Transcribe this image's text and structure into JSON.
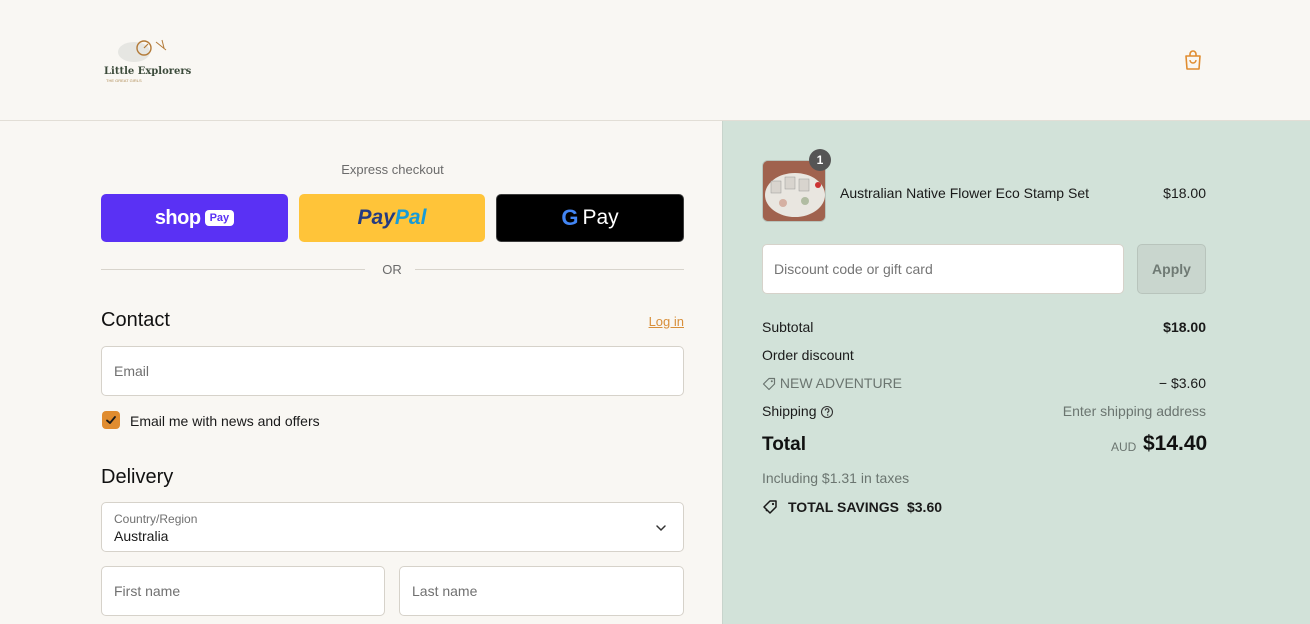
{
  "header": {
    "logo_text": "Little Explorers",
    "logo_sub": "THE GREAT             GIRLS",
    "bag_icon": "shopping-bag-icon"
  },
  "express": {
    "title": "Express checkout",
    "shop_pay": {
      "word": "shop",
      "pay": "Pay"
    },
    "paypal": {
      "part1": "Pay",
      "part2": "Pal"
    },
    "gpay": {
      "g": "G",
      "word": "Pay"
    },
    "or_text": "OR"
  },
  "contact": {
    "title": "Contact",
    "login_link": "Log in",
    "email_placeholder": "Email",
    "newsletter_label": "Email me with news and offers",
    "newsletter_checked": true
  },
  "delivery": {
    "title": "Delivery",
    "country_label": "Country/Region",
    "country_value": "Australia",
    "first_name_placeholder": "First name",
    "last_name_placeholder": "Last name"
  },
  "summary": {
    "product": {
      "name": "Australian Native Flower Eco Stamp Set",
      "price": "$18.00",
      "quantity": "1"
    },
    "discount_placeholder": "Discount code or gift card",
    "apply_label": "Apply",
    "subtotal_label": "Subtotal",
    "subtotal_value": "$18.00",
    "order_discount_label": "Order discount",
    "discount_code": "NEW ADVENTURE",
    "discount_value": "− $3.60",
    "shipping_label": "Shipping",
    "shipping_value": "Enter shipping address",
    "total_label": "Total",
    "total_currency": "AUD",
    "total_value": "$14.40",
    "taxes_text": "Including $1.31 in taxes",
    "savings_label": "TOTAL SAVINGS",
    "savings_value": "$3.60"
  },
  "colors": {
    "accent": "#e08c2f",
    "shop_pay": "#5a31f4",
    "paypal": "#ffc439",
    "summary_bg": "#d2e2d9"
  }
}
